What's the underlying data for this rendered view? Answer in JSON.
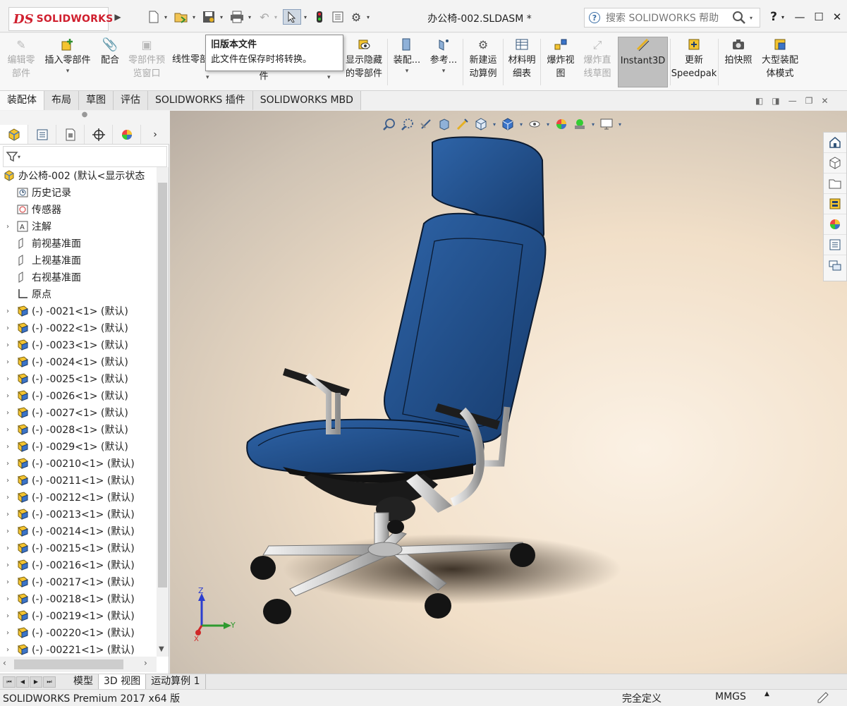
{
  "app": {
    "logo_prefix": "DS",
    "logo_text": "SOLIDWORKS",
    "doc_title": "办公椅-002.SLDASM *",
    "search_placeholder": "搜索 SOLIDWORKS 帮助"
  },
  "ribbon": {
    "buttons": [
      {
        "label1": "编辑零",
        "label2": "部件",
        "disabled": true,
        "icon": "edit-component-icon"
      },
      {
        "label1": "插入零部件",
        "label2": "",
        "disabled": false,
        "icon": "insert-component-icon"
      },
      {
        "label1": "配合",
        "label2": "",
        "disabled": false,
        "icon": "mate-icon"
      },
      {
        "label1": "零部件预",
        "label2": "览窗口",
        "disabled": true,
        "icon": "component-preview-icon"
      },
      {
        "label1": "线性零部",
        "label2": "件",
        "disabled": false,
        "icon": "linear-pattern-icon"
      },
      {
        "label1": "显示隐藏",
        "label2": "的零部件",
        "disabled": false,
        "icon": "show-hidden-icon"
      },
      {
        "label1": "装配...",
        "label2": "",
        "disabled": false,
        "icon": "assembly-features-icon"
      },
      {
        "label1": "参考...",
        "label2": "",
        "disabled": false,
        "icon": "reference-geometry-icon"
      },
      {
        "label1": "新建运",
        "label2": "动算例",
        "disabled": false,
        "icon": "motion-study-icon"
      },
      {
        "label1": "材料明",
        "label2": "细表",
        "disabled": false,
        "icon": "bom-icon"
      },
      {
        "label1": "爆炸视",
        "label2": "图",
        "disabled": false,
        "icon": "exploded-view-icon"
      },
      {
        "label1": "爆炸直",
        "label2": "线草图",
        "disabled": true,
        "icon": "explode-line-icon"
      },
      {
        "label1": "Instant3D",
        "label2": "",
        "disabled": false,
        "icon": "instant3d-icon"
      },
      {
        "label1": "更新",
        "label2": "Speedpak",
        "disabled": false,
        "icon": "speedpak-icon"
      },
      {
        "label1": "拍快照",
        "label2": "",
        "disabled": false,
        "icon": "snapshot-icon"
      },
      {
        "label1": "大型装配",
        "label2": "体模式",
        "disabled": false,
        "icon": "large-assembly-icon"
      }
    ]
  },
  "tooltip": {
    "title": "旧版本文件",
    "body": "此文件在保存时将转换。"
  },
  "command_tabs": [
    "装配体",
    "布局",
    "草图",
    "评估",
    "SOLIDWORKS 插件",
    "SOLIDWORKS MBD"
  ],
  "tree": {
    "root": "办公椅-002  (默认<显示状态",
    "items": [
      {
        "label": "历史记录",
        "icon": "history-icon",
        "expand": false
      },
      {
        "label": "传感器",
        "icon": "sensor-icon",
        "expand": false
      },
      {
        "label": "注解",
        "icon": "annotation-icon",
        "expand": true
      },
      {
        "label": "前视基准面",
        "icon": "plane-icon",
        "expand": false
      },
      {
        "label": "上视基准面",
        "icon": "plane-icon",
        "expand": false
      },
      {
        "label": "右视基准面",
        "icon": "plane-icon",
        "expand": false
      },
      {
        "label": "原点",
        "icon": "origin-icon",
        "expand": false
      }
    ],
    "parts": [
      "(-) -0021<1> (默认)",
      "(-) -0022<1> (默认)",
      "(-) -0023<1> (默认)",
      "(-) -0024<1> (默认)",
      "(-) -0025<1> (默认)",
      "(-) -0026<1> (默认)",
      "(-) -0027<1> (默认)",
      "(-) -0028<1> (默认)",
      "(-) -0029<1> (默认)",
      "(-) -00210<1> (默认)",
      "(-) -00211<1> (默认)",
      "(-) -00212<1> (默认)",
      "(-) -00213<1> (默认)",
      "(-) -00214<1> (默认)",
      "(-) -00215<1> (默认)",
      "(-) -00216<1> (默认)",
      "(-) -00217<1> (默认)",
      "(-) -00218<1> (默认)",
      "(-) -00219<1> (默认)",
      "(-) -00220<1> (默认)",
      "(-) -00221<1> (默认)"
    ]
  },
  "triad": {
    "x": "X",
    "y": "Y",
    "z": "Z"
  },
  "bottom_tabs": [
    "模型",
    "3D 视图",
    "运动算例 1"
  ],
  "status": {
    "left": "SOLIDWORKS Premium 2017 x64 版",
    "state": "完全定义",
    "units": "MMGS"
  },
  "colors": {
    "chair_blue": "#1f4f8e",
    "brand_red": "#d0202f"
  }
}
